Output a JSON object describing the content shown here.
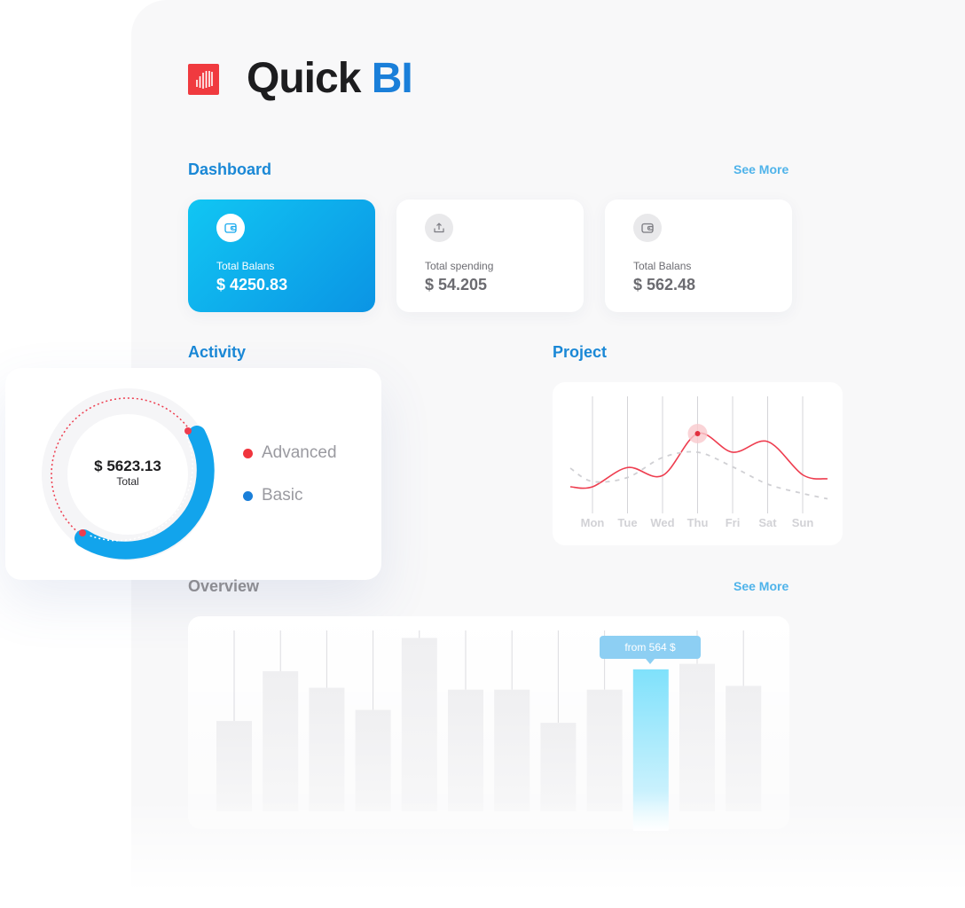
{
  "brand": {
    "name_part1": "Quick",
    "name_part2": "BI",
    "logo_color": "#f03a3f",
    "accent": "#1a7fd9"
  },
  "dashboard": {
    "title": "Dashboard",
    "see_more": "See More",
    "cards": [
      {
        "label": "Total Balans",
        "value": "$ 4250.83",
        "icon": "wallet-icon",
        "active": true
      },
      {
        "label": "Total spending",
        "value": "$ 54.205",
        "icon": "upload-icon",
        "active": false
      },
      {
        "label": "Total Balans",
        "value": "$ 562.48",
        "icon": "wallet-icon",
        "active": false
      }
    ]
  },
  "activity": {
    "title": "Activity",
    "total_value": "$ 5623.13",
    "total_label": "Total",
    "legend": [
      {
        "label": "Advanced",
        "color": "#f0343d"
      },
      {
        "label": "Basic",
        "color": "#1a7fd9"
      }
    ]
  },
  "project": {
    "title": "Project",
    "chart_data": {
      "type": "line",
      "x": [
        "Mon",
        "Tue",
        "Wed",
        "Thu",
        "Fri",
        "Sat",
        "Sun"
      ],
      "series": [
        {
          "values": [
            0.2,
            0.49,
            0.37,
            1.0,
            0.72,
            0.88,
            0.38
          ],
          "color": "#ee3d4f",
          "style": "solid"
        },
        {
          "values": [
            0.28,
            0.34,
            0.64,
            0.72,
            0.5,
            0.24,
            0.1
          ],
          "color": "#d0d0d4",
          "style": "dashed"
        }
      ],
      "highlight_x": "Thu",
      "grid": true
    }
  },
  "overview": {
    "title": "Overview",
    "see_more": "See More",
    "tooltip": "from 564 $",
    "chart_data": {
      "type": "bar",
      "categories": [
        "",
        "",
        "",
        "",
        "",
        "",
        "",
        "",
        "",
        "",
        "",
        ""
      ],
      "values": [
        0.49,
        0.76,
        0.67,
        0.55,
        0.94,
        0.66,
        0.66,
        0.48,
        0.66,
        0.77,
        0.8,
        0.68
      ],
      "highlight_index": 9,
      "highlight_color": "#7fe1fb"
    }
  }
}
